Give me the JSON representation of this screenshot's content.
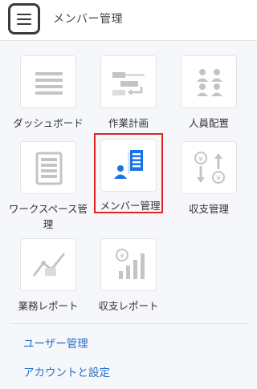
{
  "header": {
    "menu_icon": "hamburger-menu-icon",
    "title": "メンバー管理"
  },
  "tiles": [
    {
      "label": "ダッシュボード",
      "icon": "dashboard-icon"
    },
    {
      "label": "作業計画",
      "icon": "work-plan-icon"
    },
    {
      "label": "人員配置",
      "icon": "staff-allocation-icon"
    },
    {
      "label": "ワークスペース管理",
      "icon": "workspace-icon"
    },
    {
      "label": "メンバー管理",
      "icon": "member-management-icon",
      "selected": true
    },
    {
      "label": "収支管理",
      "icon": "income-expense-icon"
    },
    {
      "label": "業務レポート",
      "icon": "business-report-icon"
    },
    {
      "label": "収支レポート",
      "icon": "income-report-icon"
    }
  ],
  "links": [
    {
      "label": "ユーザー管理"
    },
    {
      "label": "アカウントと設定"
    }
  ],
  "colors": {
    "selected_border": "#e32424",
    "link": "#2470c9",
    "icon_gray": "#c4c4c4",
    "accent_blue": "#1a73e8"
  }
}
